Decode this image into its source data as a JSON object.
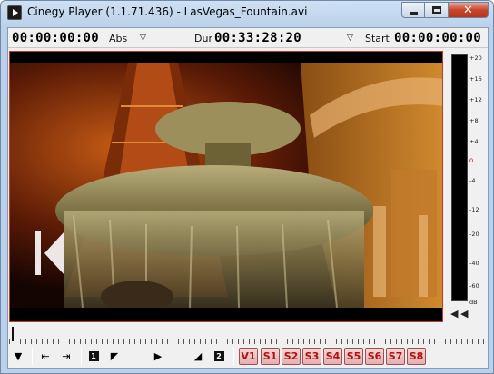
{
  "window": {
    "title": "Cinegy Player (1.1.71.436) - LasVegas_Fountain.avi"
  },
  "timecode_bar": {
    "position_tc": "00:00:00:00",
    "mode_label": "Abs",
    "duration_label": "Dur",
    "duration_tc": "00:33:28:20",
    "start_label": "Start",
    "start_tc": "00:00:00:00"
  },
  "audio_meter": {
    "ticks": [
      "+20",
      "+16",
      "+12",
      "+8",
      "+4",
      "0",
      "-4",
      "-12",
      "-20",
      "-40",
      "-60",
      "dB"
    ],
    "zero_color": "#d00000"
  },
  "tracks": [
    "V1",
    "S1",
    "S2",
    "S3",
    "S4",
    "S5",
    "S6",
    "S7",
    "S8"
  ],
  "icons": {
    "mark_in": "1",
    "mark_out": "2"
  }
}
